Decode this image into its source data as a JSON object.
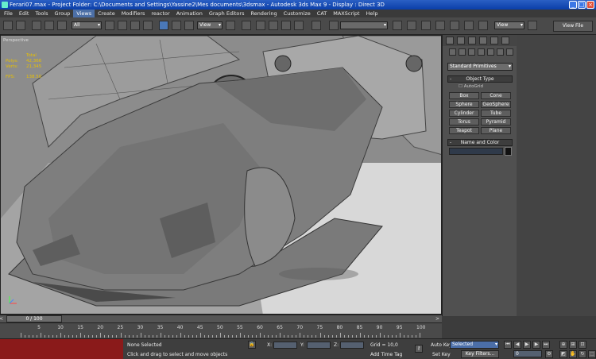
{
  "window": {
    "title": "Ferari07.max    - Project Folder: C:\\Documents and Settings\\Yassine2\\Mes documents\\3dsmax     - Autodesk 3ds Max 9     - Display : Direct 3D"
  },
  "menu": [
    "File",
    "Edit",
    "Tools",
    "Group",
    "Views",
    "Create",
    "Modifiers",
    "reactor",
    "Animation",
    "Graph Editors",
    "Rendering",
    "Customize",
    "CAT",
    "MAXScript",
    "Help"
  ],
  "toolbar": {
    "filter_value": "All",
    "ref_coord_value": "View",
    "named_sel_value": "",
    "viewport_value": "View",
    "view_file_label": "View File"
  },
  "viewport": {
    "label": "Perspective",
    "stats": [
      {
        "k": "",
        "v": "Total"
      },
      {
        "k": "Polys:",
        "v": "42,366"
      },
      {
        "k": "Verts:",
        "v": "21,345"
      },
      {
        "k": "FPS:",
        "v": "138.50"
      }
    ]
  },
  "command_panel": {
    "category": "Standard Primitives",
    "object_type_title": "Object Type",
    "autogrid_label": "AutoGrid",
    "primitives": [
      "Box",
      "Cone",
      "Sphere",
      "GeoSphere",
      "Cylinder",
      "Tube",
      "Torus",
      "Pyramid",
      "Teapot",
      "Plane"
    ],
    "name_color_title": "Name and Color"
  },
  "timeline": {
    "frame_label": "0 / 100",
    "prev": "<",
    "next": ">",
    "ticks": [
      "5",
      "10",
      "15",
      "20",
      "25",
      "30",
      "35",
      "40",
      "45",
      "50",
      "55",
      "60",
      "65",
      "70",
      "75",
      "80",
      "85",
      "90",
      "95",
      "100"
    ]
  },
  "status": {
    "selection": "None Selected",
    "prompt": "Click and drag to select and move objects",
    "x_label": "X:",
    "y_label": "Y:",
    "z_label": "Z:",
    "grid": "Grid = 10,0",
    "add_time_tag": "Add Time Tag",
    "auto_key": "Auto Key",
    "set_key": "Set Key",
    "selected_value": "Selected",
    "key_filters": "Key Filters...",
    "frame_value": "0"
  }
}
